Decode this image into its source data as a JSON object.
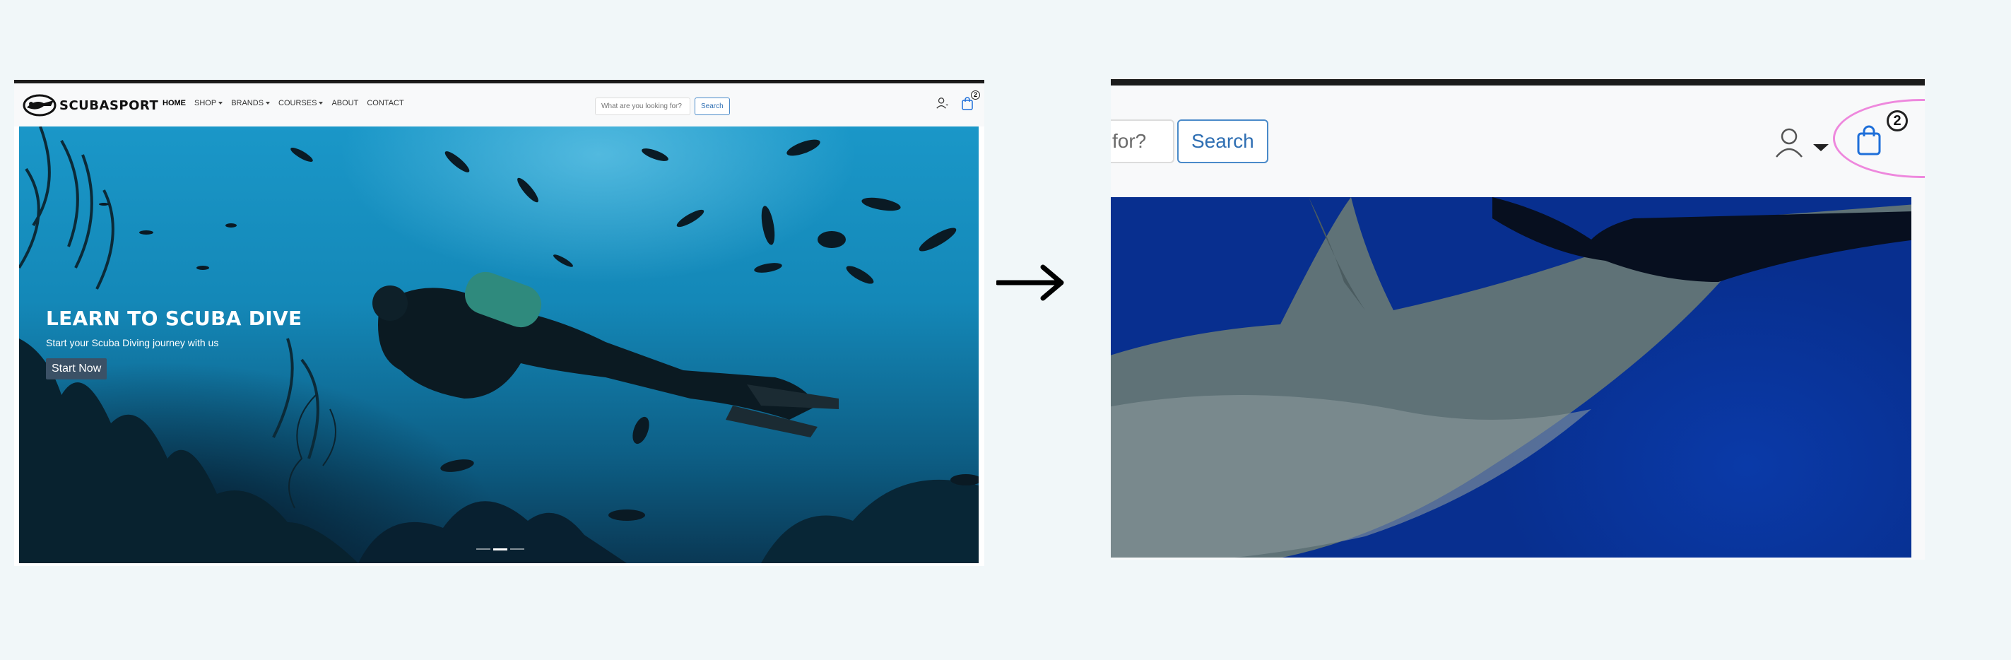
{
  "brand": {
    "name": "SCUBASPORT"
  },
  "nav": {
    "links": [
      {
        "label": "HOME",
        "active": true,
        "dropdown": false
      },
      {
        "label": "SHOP",
        "active": false,
        "dropdown": true
      },
      {
        "label": "BRANDS",
        "active": false,
        "dropdown": true
      },
      {
        "label": "COURSES",
        "active": false,
        "dropdown": true
      },
      {
        "label": "ABOUT",
        "active": false,
        "dropdown": false
      },
      {
        "label": "CONTACT",
        "active": false,
        "dropdown": false
      }
    ]
  },
  "search": {
    "placeholder": "What are you looking for?",
    "button_label": "Search",
    "zoomed_visible_text": "for?"
  },
  "account": {
    "icon": "user-icon"
  },
  "cart": {
    "icon": "shopping-bag-icon",
    "count": "2"
  },
  "hero": {
    "title": "LEARN TO SCUBA DIVE",
    "subtitle": "Start your Scuba Diving journey with us",
    "cta_label": "Start Now",
    "slides": 3,
    "active_slide": 2
  },
  "colors": {
    "accent": "#2f6fb3",
    "cart_icon": "#1e6fd9",
    "highlight": "#ee88dd",
    "cta_bg": "#3b5166"
  },
  "icons": {
    "transition": "right-arrow-icon"
  }
}
